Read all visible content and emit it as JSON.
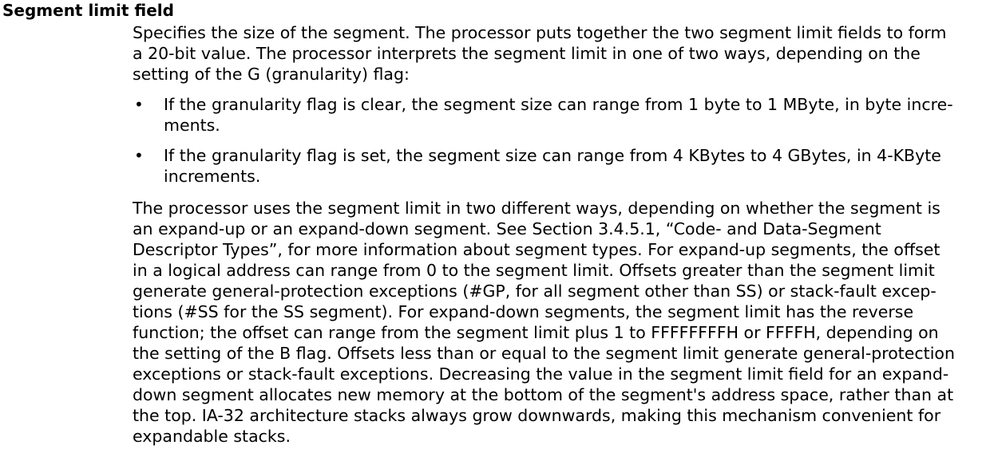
{
  "heading": "Segment limit field",
  "paragraph1": [
    "Specifies the size of the segment. The processor puts together the two segment limit fields to form",
    "a 20-bit value. The processor interprets the segment limit in one of two ways, depending on the",
    "setting of the G (granularity) flag:"
  ],
  "bullet_symbol": "•",
  "bullets": [
    {
      "lines": [
        "If the granularity flag is clear, the segment size can range from 1 byte to 1 MByte, in byte incre-",
        "ments."
      ]
    },
    {
      "lines": [
        "If the granularity flag is set, the segment size can range from 4 KBytes to 4 GBytes, in 4-KByte",
        "increments."
      ]
    }
  ],
  "paragraph2": [
    "The processor uses the segment limit in two different ways, depending on whether the segment is",
    "an expand-up or an expand-down segment. See Section 3.4.5.1, “Code- and Data-Segment",
    "Descriptor Types”, for more information about segment types. For expand-up segments, the offset",
    "in a logical address can range from 0 to the segment limit. Offsets greater than the segment limit",
    "generate general-protection exceptions (#GP, for all segment other than SS) or stack-fault excep-",
    "tions (#SS for the SS segment). For expand-down segments, the segment limit has the reverse",
    "function; the offset can range from the segment limit plus 1 to FFFFFFFFH or FFFFH, depending on",
    "the setting of the B flag. Offsets less than or equal to the segment limit generate general-protection",
    "exceptions or stack-fault exceptions. Decreasing the value in the segment limit field for an expand-",
    "down segment allocates new memory at the bottom of the segment's address space, rather than at",
    "the top. IA-32 architecture stacks always grow downwards, making this mechanism convenient for",
    "expandable stacks."
  ]
}
